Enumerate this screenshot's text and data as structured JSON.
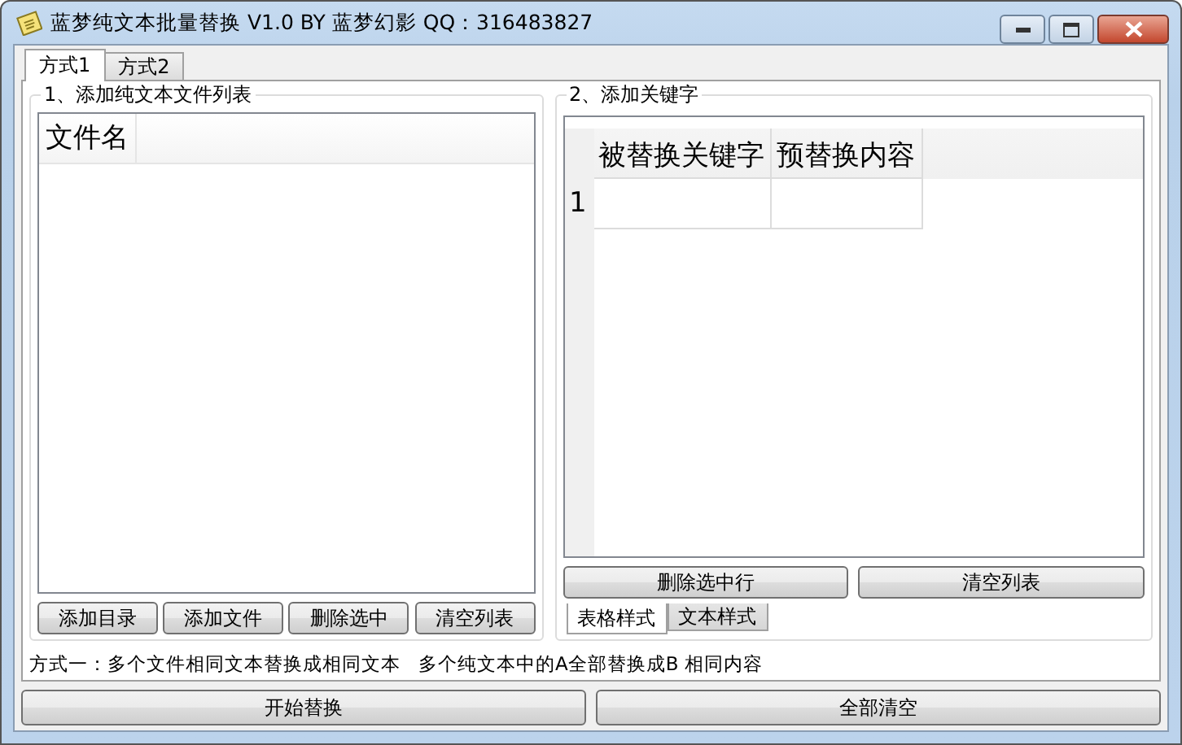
{
  "window": {
    "title": "蓝梦纯文本批量替换 V1.0 BY 蓝梦幻影 QQ：316483827"
  },
  "tabs": [
    {
      "label": "方式1",
      "selected": true
    },
    {
      "label": "方式2",
      "selected": false
    }
  ],
  "file_group": {
    "title": "1、添加纯文本文件列表",
    "columns": [
      "文件名"
    ],
    "buttons": [
      "添加目录",
      "添加文件",
      "删除选中",
      "清空列表"
    ]
  },
  "keyword_group": {
    "title": "2、添加关键字",
    "columns": [
      "被替换关键字",
      "预替换内容"
    ],
    "rows": [
      {
        "number": "1"
      }
    ],
    "buttons": [
      "删除选中行",
      "清空列表"
    ],
    "tabs": [
      {
        "label": "表格样式",
        "selected": true
      },
      {
        "label": "文本样式",
        "selected": false
      }
    ]
  },
  "status_text": "方式一：多个文件相同文本替换成相同文本   多个纯文本中的A全部替换成B 相同内容",
  "bottom_buttons": [
    "开始替换",
    "全部清空"
  ]
}
